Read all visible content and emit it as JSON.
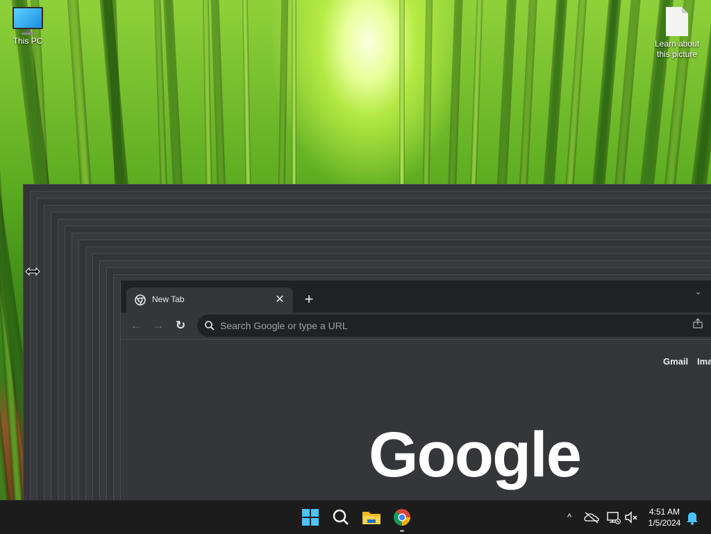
{
  "desktop": {
    "icons": [
      {
        "label": "This PC",
        "icon": "this-pc-icon"
      },
      {
        "label": "Learn about this picture",
        "icon": "document-icon"
      }
    ]
  },
  "browser": {
    "tab": {
      "title": "New Tab",
      "favicon": "chrome-icon",
      "close": "✕"
    },
    "new_tab": "+",
    "tab_search": "⌄",
    "nav": {
      "back": "←",
      "forward": "→",
      "reload": "↻"
    },
    "omnibox": {
      "placeholder": "Search Google or type a URL"
    },
    "page": {
      "links": [
        "Gmail",
        "Ima"
      ],
      "logo": "Google"
    }
  },
  "taskbar": {
    "apps": [
      "windows-start-icon",
      "search-icon",
      "file-explorer-icon",
      "chrome-icon"
    ],
    "tray": {
      "chevron": "^",
      "icons": [
        "onedrive-icon",
        "network-icon",
        "volume-muted-icon",
        "notification-bell-icon"
      ]
    },
    "clock": {
      "time": "4:51 AM",
      "date": "1/5/2024"
    }
  },
  "colors": {
    "taskbar_bg": "#1c1c1c",
    "chrome_dark": "#35363a",
    "chrome_frame": "#202124",
    "accent_blue": "#4cc2ff"
  }
}
